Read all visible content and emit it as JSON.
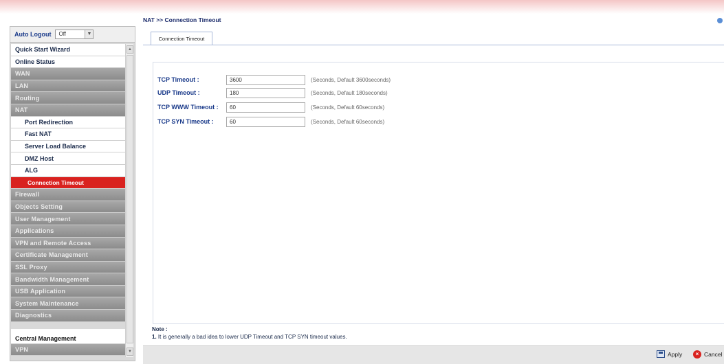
{
  "auto_logout": {
    "label": "Auto Logout",
    "value": "Off"
  },
  "menu": [
    {
      "label": "Quick Start Wizard",
      "style": "white"
    },
    {
      "label": "Online Status",
      "style": "white"
    },
    {
      "label": "WAN",
      "style": "gray"
    },
    {
      "label": "LAN",
      "style": "gray"
    },
    {
      "label": "Routing",
      "style": "gray"
    },
    {
      "label": "NAT",
      "style": "gray"
    },
    {
      "label": "Port Redirection",
      "style": "sub"
    },
    {
      "label": "Fast NAT",
      "style": "sub"
    },
    {
      "label": "Server Load Balance",
      "style": "sub"
    },
    {
      "label": "DMZ Host",
      "style": "sub"
    },
    {
      "label": "ALG",
      "style": "sub"
    },
    {
      "label": "Connection Timeout",
      "style": "active"
    },
    {
      "label": "Firewall",
      "style": "gray"
    },
    {
      "label": "Objects Setting",
      "style": "gray"
    },
    {
      "label": "User Management",
      "style": "gray"
    },
    {
      "label": "Applications",
      "style": "gray"
    },
    {
      "label": "VPN and Remote Access",
      "style": "gray"
    },
    {
      "label": "Certificate Management",
      "style": "gray"
    },
    {
      "label": "SSL Proxy",
      "style": "gray"
    },
    {
      "label": "Bandwidth Management",
      "style": "gray"
    },
    {
      "label": "USB Application",
      "style": "gray"
    },
    {
      "label": "System Maintenance",
      "style": "gray"
    },
    {
      "label": "Diagnostics",
      "style": "gray"
    },
    {
      "label": "Central Management",
      "style": "cm"
    },
    {
      "label": "VPN",
      "style": "gray"
    }
  ],
  "breadcrumb": "NAT >> Connection Timeout",
  "tab": "Connection Timeout",
  "fields": [
    {
      "name": "TCP Timeout :",
      "value": "3600",
      "hint": "(Seconds, Default 3600seconds)"
    },
    {
      "name": "UDP Timeout :",
      "value": "180",
      "hint": "(Seconds, Default 180seconds)"
    },
    {
      "name": "TCP WWW Timeout :",
      "value": "60",
      "hint": "(Seconds, Default 60seconds)"
    },
    {
      "name": "TCP SYN Timeout :",
      "value": "60",
      "hint": "(Seconds, Default 60seconds)"
    }
  ],
  "note": {
    "title": "Note :",
    "line1_num": "1.",
    "line1": "It is generally a bad idea to lower UDP Timeout and TCP SYN timeout values."
  },
  "buttons": {
    "apply": "Apply",
    "cancel": "Cancel"
  }
}
